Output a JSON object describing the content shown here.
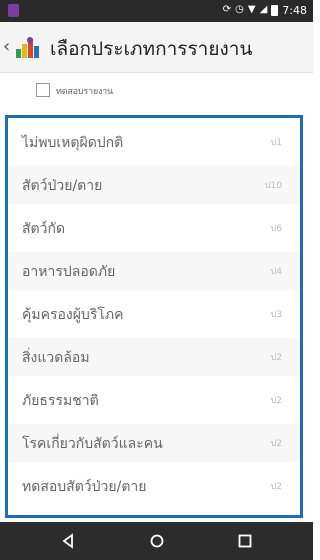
{
  "status_bar": {
    "time": "7:48"
  },
  "app_bar": {
    "title": "เลือกประเภทการรายงาน"
  },
  "test_checkbox": {
    "label": "ทดสอบรายงาน",
    "checked": false
  },
  "report_types": [
    {
      "label": "ไม่พบเหตุผิดปกติ",
      "value": "ป1"
    },
    {
      "label": "สัตว์ป่วย/ตาย",
      "value": "ป10"
    },
    {
      "label": "สัตว์กัด",
      "value": "ป6"
    },
    {
      "label": "อาหารปลอดภัย",
      "value": "ป4"
    },
    {
      "label": "คุ้มครองผู้บริโภค",
      "value": "ป3"
    },
    {
      "label": "สิ่งแวดล้อม",
      "value": "ป2"
    },
    {
      "label": "ภัยธรรมชาติ",
      "value": "ป2"
    },
    {
      "label": "โรคเกี่ยวกับสัตว์และคน",
      "value": "ป2"
    },
    {
      "label": "ทดสอบสัตว์ป่วย/ตาย",
      "value": "ป2"
    }
  ],
  "colors": {
    "list_border": "#1c6fb7",
    "status_bar": "#2a2a2a",
    "nav_bar": "#2c2c2c"
  }
}
